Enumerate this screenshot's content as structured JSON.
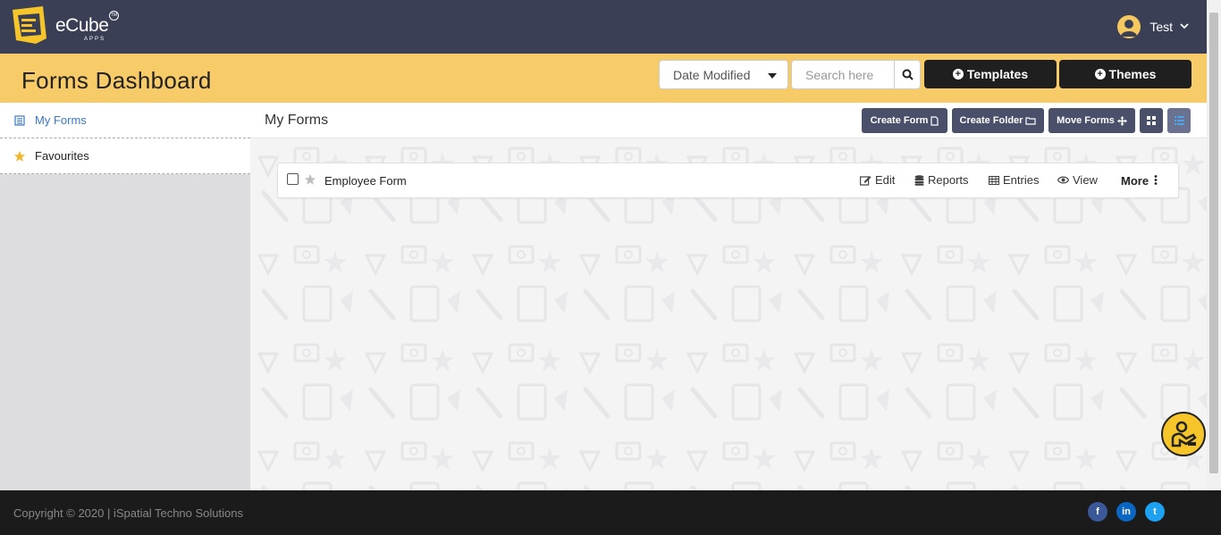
{
  "app": {
    "logo_text": "eCube",
    "logo_sub": "APPS",
    "logo_tm": "TM"
  },
  "user": {
    "name": "Test"
  },
  "header": {
    "title": "Forms Dashboard",
    "sort_value": "Date Modified",
    "search_placeholder": "Search here",
    "templates_label": "Templates",
    "themes_label": "Themes"
  },
  "sidebar": {
    "items": [
      {
        "label": "My Forms",
        "icon": "list-icon",
        "active": true
      },
      {
        "label": "Favourites",
        "icon": "star-icon",
        "active": false
      }
    ]
  },
  "main": {
    "title": "My Forms",
    "buttons": {
      "create_form": "Create Form",
      "create_folder": "Create Folder",
      "move_forms": "Move Forms"
    },
    "forms": [
      {
        "name": "Employee Form",
        "actions": [
          "Edit",
          "Reports",
          "Entries",
          "View"
        ],
        "more_label": "More"
      }
    ]
  },
  "footer": {
    "copyright": "Copyright © 2020 | iSpatial Techno Solutions",
    "social": [
      "f",
      "in",
      "t"
    ]
  },
  "colors": {
    "topbar": "#3b3f55",
    "header": "#f8cb69",
    "accent_link": "#3b78c2",
    "dark_button": "#1f1f1f",
    "slate_button": "#4a5069",
    "footer": "#1b1b1b"
  }
}
